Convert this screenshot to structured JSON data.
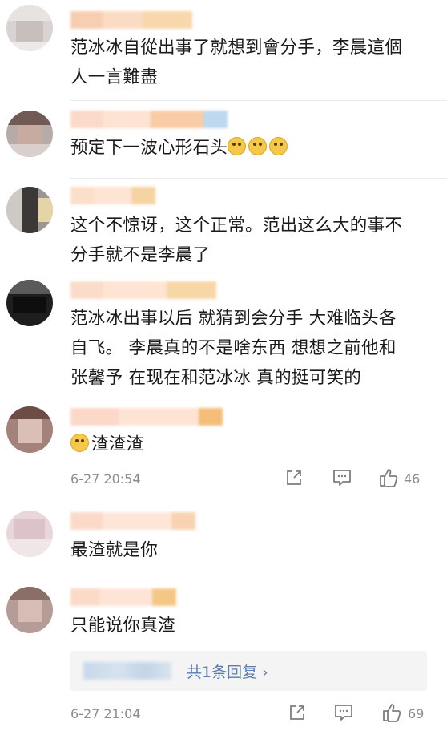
{
  "comments": [
    {
      "text_line1": "范冰冰自從出事了就想到會分手，李晨這個",
      "text_line2": "人一言難盡"
    },
    {
      "text": "预定下一波心形石头",
      "emoji_count": 3,
      "emoji_icon": "doge-icon"
    },
    {
      "text_line1": "这个不惊讶，这个正常。范出这么大的事不",
      "text_line2": "分手就不是李晨了"
    },
    {
      "text_line1": "范冰冰出事以后 就猜到会分手 大难临头各",
      "text_line2": "自飞。 李晨真的不是啥东西 想想之前他和",
      "text_line3": "张馨予 在现在和范冰冰 真的挺可笑的"
    },
    {
      "text": "渣渣渣",
      "emoji_icon": "drool-icon",
      "time": "6-27 20:54",
      "likes": "46"
    },
    {
      "text": "最渣就是你"
    },
    {
      "text": "只能说你真渣",
      "reply_link": "共1条回复 ›",
      "time": "6-27 21:04",
      "likes": "69"
    }
  ]
}
